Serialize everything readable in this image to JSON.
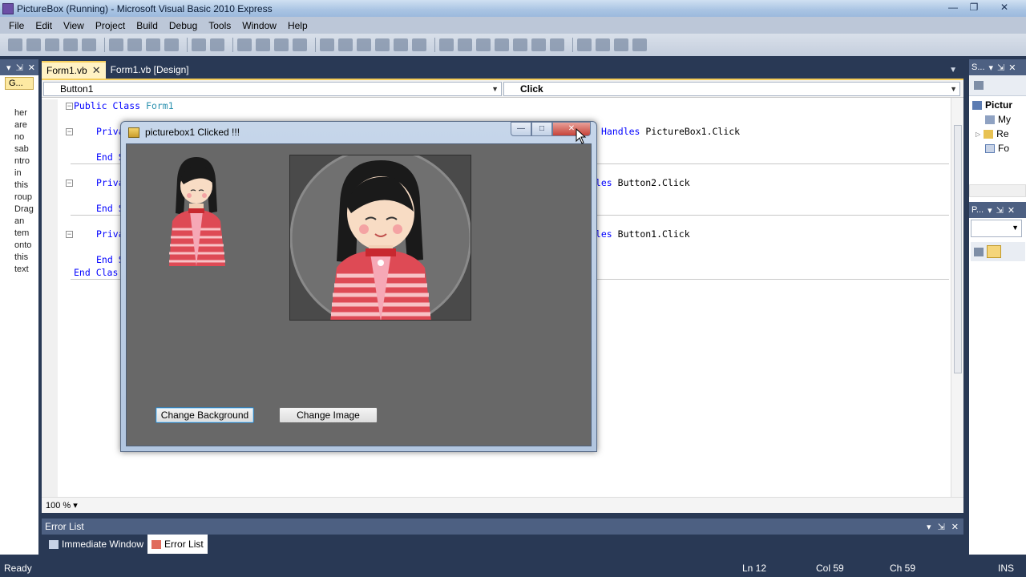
{
  "window": {
    "title": "PictureBox (Running) - Microsoft Visual Basic 2010 Express"
  },
  "menu": [
    "File",
    "Edit",
    "View",
    "Project",
    "Build",
    "Debug",
    "Tools",
    "Window",
    "Help"
  ],
  "toolbox": {
    "tab_label": "G...",
    "help_text": [
      "her",
      "are",
      "no",
      "sab",
      "ntro",
      "in",
      "this",
      "roup",
      "Drag",
      "an",
      "tem",
      "onto",
      "this",
      "text"
    ]
  },
  "tabs": [
    {
      "label": "Form1.vb",
      "active": true
    },
    {
      "label": "Form1.vb [Design]",
      "active": false
    }
  ],
  "navbar": {
    "object": "Button1",
    "event": "Click"
  },
  "code": {
    "line1_kw": "Public Class",
    "line1_type": "Form1",
    "priv_kw": "Priva",
    "end_kw": "End S",
    "end_class": "End Clas",
    "handles1_kw": "Handles",
    "handles1": "PictureBox1.Click",
    "handles2_kw": "dles",
    "handles2": "Button2.Click",
    "handles3_kw": "dles",
    "handles3": "Button1.Click",
    "zoom": "100 %"
  },
  "form": {
    "title": "picturebox1 Clicked !!!",
    "btn_bg": "Change Background",
    "btn_image": "Change Image"
  },
  "right_top": {
    "title": "S...",
    "items": [
      "Pictur",
      "My",
      "Re",
      "Fo"
    ]
  },
  "right_bottom": {
    "title": "P..."
  },
  "errorlist": {
    "title": "Error List",
    "tabs": [
      "Immediate Window",
      "Error List"
    ]
  },
  "status": {
    "ready": "Ready",
    "ln": "Ln 12",
    "col": "Col 59",
    "ch": "Ch 59",
    "ins": "INS"
  },
  "colors": {
    "ide_dark": "#293955",
    "tab_active": "#fff2c4",
    "form_client": "#686868",
    "close_red": "#c7433a"
  }
}
